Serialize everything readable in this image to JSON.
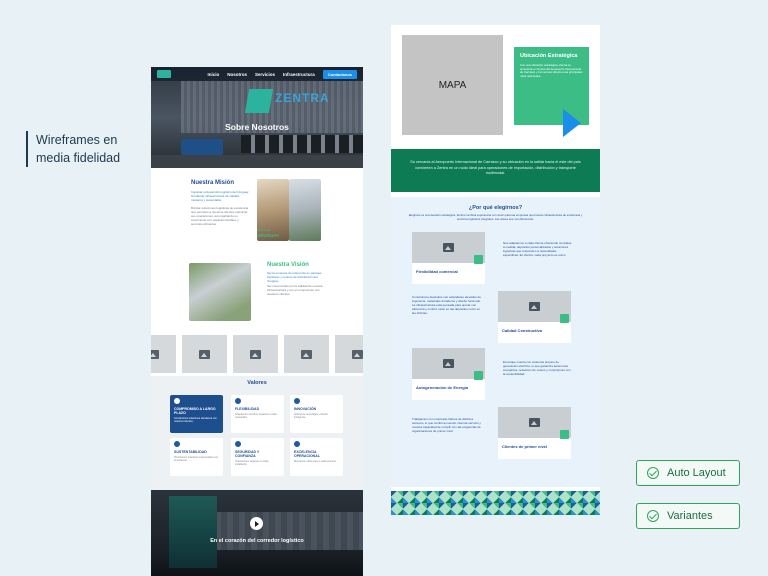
{
  "side_title": "Wireframes en media fidelidad",
  "badges": {
    "auto_layout": "Auto Layout",
    "variantes": "Variantes"
  },
  "left": {
    "nav": {
      "items": [
        "Inicio",
        "Nosotros",
        "Servicios",
        "Infraestructura"
      ],
      "cta": "Contáctanos"
    },
    "hero": {
      "brand": "ZENTRA",
      "title": "Sobre Nosotros"
    },
    "mision": {
      "title": "Nuestra Misión",
      "p1": "Impulsar el desarrollo logístico del Uruguay brindando infraestructura de calidad, moderna y sustentable.",
      "p2": "Brindar soluciones logísticas de excelencia que permitan a nuestros clientes optimizar sus operaciones, acompañando su crecimiento con espacios flexibles y servicios eficientes.",
      "photo_caption": "HECHO EN",
      "photo_label": "URUGUAY"
    },
    "vision": {
      "title": "Nuestra Visión",
      "p1": "Ser la empresa de referencia en parques logísticos y centros de distribución del Uruguay.",
      "p2": "Ser reconocidos por la calidad de nuestra infraestructura y por el compromiso con nuestros clientes."
    },
    "valores": {
      "title": "Valores",
      "items": [
        {
          "title": "COMPROMISO A LARGO PLAZO",
          "desc": "Construimos relaciones duraderas con nuestros clientes."
        },
        {
          "title": "FLEXIBILIDAD",
          "desc": "Adaptamos nuestros espacios a cada necesidad."
        },
        {
          "title": "INNOVACIÓN",
          "desc": "Aplicamos tecnología y diseño inteligente."
        },
        {
          "title": "SUSTENTABILIDAD",
          "desc": "Priorizamos prácticas responsables con el ambiente."
        },
        {
          "title": "SEGURIDAD Y CONFIANZA",
          "desc": "Operaciones seguras en cada instalación."
        },
        {
          "title": "EXCELENCIA OPERACIONAL",
          "desc": "Buscamos eficiencia en cada proceso."
        }
      ]
    },
    "video": {
      "caption": "En el corazón del corredor logístico"
    }
  },
  "right": {
    "map_label": "MAPA",
    "ubicacion": {
      "title": "Ubicación Estratégica",
      "desc": "Con una ubicación estratégica, Zentra se encuentra a minutos del Aeropuerto Internacional de Carrasco y con acceso directo a las principales rutas nacionales."
    },
    "banner": "Su cercanía al Aeropuerto Internacional de Carrasco y su ubicación en la salida hacia el este del país convierten a Zentra en un nodo ideal para operaciones de importación, distribución y transporte multimodal.",
    "why": {
      "title": "¿Por qué elegirnos?",
      "subtitle": "Elegirnos es una decisión estratégica. Zentra combina experiencia con visión para las empresas que buscan infraestructura de excelencia y servicios logísticos integrales. Las claves que nos diferencian:",
      "cards": [
        {
          "caption": "Flexibilidad comercial",
          "text": "Nos adaptamos a cada cliente ofreciendo contratos a medida, depósitos personalizados y soluciones logísticas que responden a necesidades específicas. En Zentra, cada proyecto es único."
        },
        {
          "caption": "Calidad Constructiva",
          "text": "Construimos depósitos con estándares elevados de ingeniería, materiales duraderos y diseño funcional. La infraestructura está pensada para operar con eficiencia y confort, tanto en las depósitos como en las oficinas."
        },
        {
          "caption": "Autogeneración de Energía",
          "text": "El parque cuenta con sistemas propios de generación eléctrica, lo que garantiza autonomía energética, reducción de costos y compromiso con la sostenibilidad."
        },
        {
          "caption": "Clientes de primer nivel",
          "text": "Trabajamos con empresas líderes de distintos sectores, lo que confirma nuestro nivel de servicio y nuestra capacidad de cumplir con las exigencias de organizaciones de primer nivel."
        }
      ]
    }
  }
}
